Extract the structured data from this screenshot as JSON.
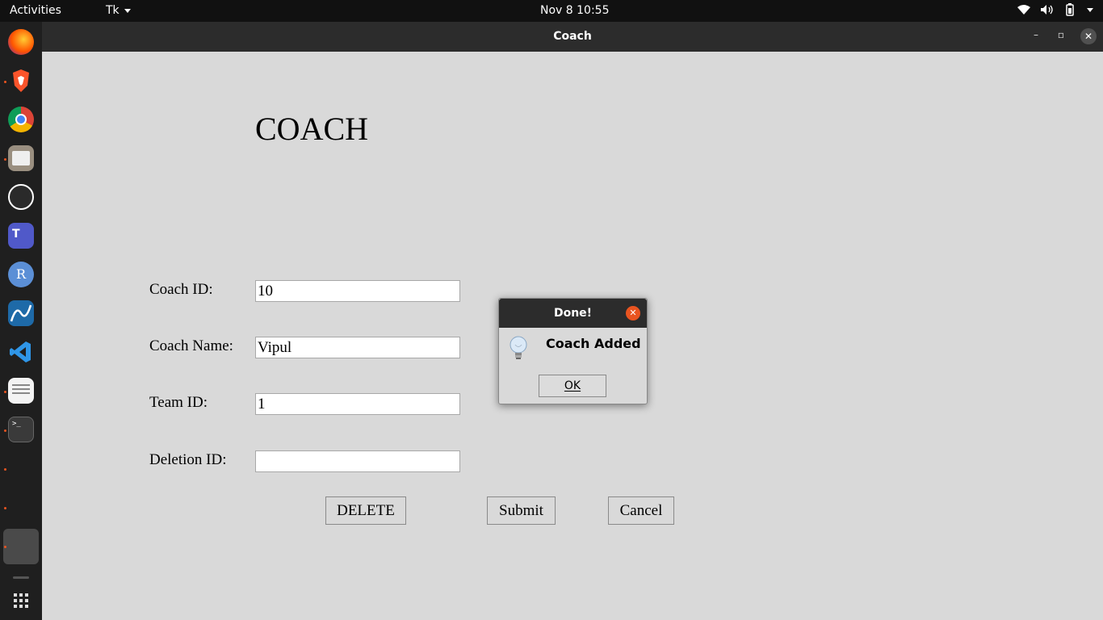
{
  "topbar": {
    "activities": "Activities",
    "app_menu": "Tk",
    "clock": "Nov 8  10:55"
  },
  "dock": {
    "items": [
      "firefox-icon",
      "brave-icon",
      "chrome-icon",
      "files-icon",
      "obs-icon",
      "teams-icon",
      "r-icon",
      "wireshark-icon",
      "vscode-icon",
      "text-editor-icon",
      "terminal-icon"
    ]
  },
  "window": {
    "title": "Coach",
    "minimize": "–",
    "maximize": "▫",
    "close": "✕"
  },
  "form": {
    "heading": "COACH",
    "fields": [
      {
        "label": "Coach ID:",
        "value": "10"
      },
      {
        "label": "Coach Name:",
        "value": "Vipul"
      },
      {
        "label": "Team ID:",
        "value": "1"
      },
      {
        "label": "Deletion ID:",
        "value": ""
      }
    ],
    "buttons": {
      "delete": "DELETE",
      "submit": "Submit",
      "cancel": "Cancel"
    }
  },
  "dialog": {
    "title": "Done!",
    "message": "Coach Added",
    "ok": "OK",
    "icon": "lightbulb-icon"
  },
  "colors": {
    "accent": "#e95420",
    "window_bg": "#d9d9d9",
    "titlebar": "#2c2c2c"
  }
}
